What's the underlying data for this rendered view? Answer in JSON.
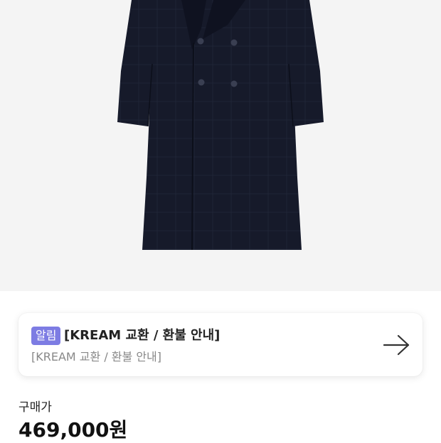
{
  "product": {
    "image_alt": "",
    "colors": {
      "background": "#f4f4f4",
      "coat": "#161a2a"
    }
  },
  "notice": {
    "badge": "알림",
    "badge_color": "#7d7ce3",
    "title": "[KREAM 교환 / 환불 안내]",
    "subtitle": "[KREAM 교환 / 환불 안내]",
    "arrow_icon": "arrow-right-icon"
  },
  "price": {
    "label": "구매가",
    "value": "469,000원"
  }
}
